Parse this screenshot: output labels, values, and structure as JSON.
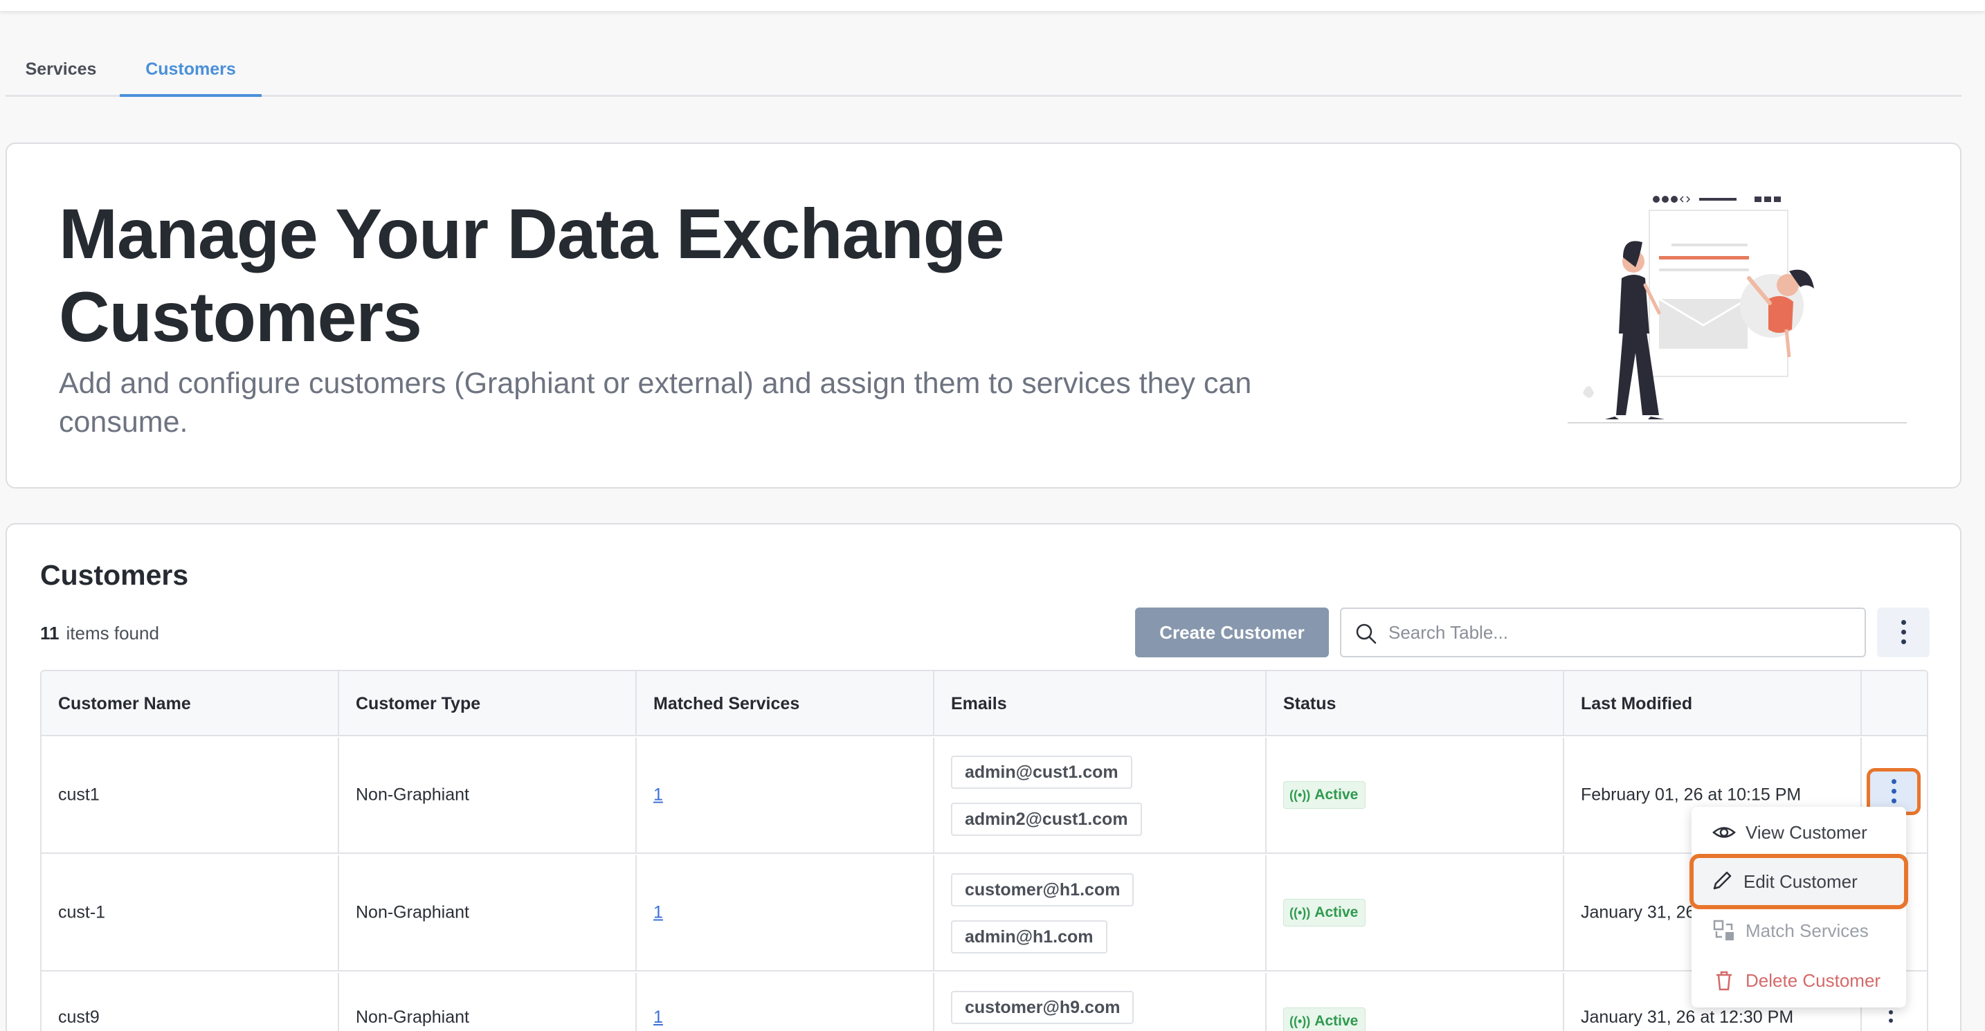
{
  "tabs": [
    {
      "label": "Services"
    },
    {
      "label": "Customers"
    }
  ],
  "hero": {
    "title": "Manage Your Data Exchange Customers",
    "subtitle": "Add and configure customers (Graphiant or external) and assign them to services they can consume."
  },
  "panel": {
    "title": "Customers",
    "items_count": "11",
    "items_label": "items found",
    "create_label": "Create Customer",
    "search_placeholder": "Search Table..."
  },
  "table": {
    "columns": [
      "Customer Name",
      "Customer Type",
      "Matched Services",
      "Emails",
      "Status",
      "Last Modified"
    ],
    "rows": [
      {
        "name": "cust1",
        "type": "Non-Graphiant",
        "matched": "1",
        "emails": [
          "admin@cust1.com",
          "admin2@cust1.com"
        ],
        "status": "Active",
        "modified": "February 01, 26 at 10:15 PM"
      },
      {
        "name": "cust-1",
        "type": "Non-Graphiant",
        "matched": "1",
        "emails": [
          "customer@h1.com",
          "admin@h1.com"
        ],
        "status": "Active",
        "modified": "January 31, 26"
      },
      {
        "name": "cust9",
        "type": "Non-Graphiant",
        "matched": "1",
        "emails": [
          "customer@h9.com"
        ],
        "status": "Active",
        "modified": "January 31, 26 at 12:30 PM"
      }
    ]
  },
  "menu": {
    "view": "View Customer",
    "edit": "Edit Customer",
    "match": "Match Services",
    "delete": "Delete Customer"
  },
  "colors": {
    "accent": "#4a90d9",
    "highlight": "#e8752c",
    "status_active": "#2f9a4e",
    "danger": "#d46a6a"
  }
}
